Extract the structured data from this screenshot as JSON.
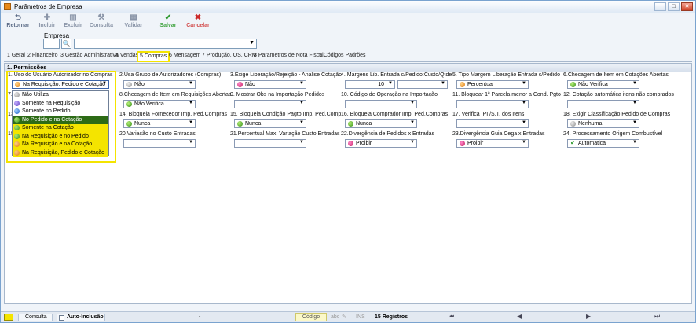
{
  "window": {
    "title": "Parâmetros de Empresa",
    "min": "_",
    "max": "□",
    "close": "✕"
  },
  "toolbar": {
    "retornar": "Retornar",
    "incluir": "Incluir",
    "excluir": "Excluir",
    "consulta": "Consulta",
    "validar": "Validar",
    "salvar": "Salvar",
    "cancelar": "Cancelar"
  },
  "empresa": {
    "label": "Empresa",
    "search_glyph": "🔍"
  },
  "tabs": [
    "1 Geral",
    "2 Financeiro",
    "3 Gestão Administrativa",
    "4 Vendas",
    "5 Compras",
    "6 Mensagem",
    "7 Produção, OS, CRM",
    "8 Parametros de Nota Fiscal",
    "9 Códigos Padrões"
  ],
  "panel": {
    "title": "1. Permissões"
  },
  "fields": {
    "f1": {
      "label": "1. Uso do Usuário Autorizador no Compras",
      "value": "Na Requisição, Pedido e Cotação"
    },
    "f2": {
      "label": "2.Usa Grupo de Autorizadores (Compras)",
      "value": "Não"
    },
    "f3": {
      "label": "3.Exige Liberação/Rejeição - Análise Cotação",
      "value": "Não"
    },
    "f4": {
      "label": "4. Margens Lib. Entrada c/Pedido:Custo/Qtde",
      "value": "10"
    },
    "f5": {
      "label": "5. Tipo Margem Liberação Entrada c/Pedido",
      "value": "Percentual"
    },
    "f6": {
      "label": "6.Checagem de Item em Cotações Abertas",
      "value": "Não Verifica"
    },
    "f7": {
      "label": "7."
    },
    "f8": {
      "label": "8.Checagem de Item em Requisições Abertas",
      "value": "Não Verifica"
    },
    "f9": {
      "label": "9. Mostrar Obs na Importação Pedidos"
    },
    "f10": {
      "label": "10. Código de Operação na Importação"
    },
    "f11": {
      "label": "11. Bloquear 1ª Parcela menor a Cond. Pgto"
    },
    "f12": {
      "label": "12. Cotação automática itens não comprados"
    },
    "f13": {
      "label": "13"
    },
    "f14": {
      "label": "14. Bloqueia Fornecedor Imp. Ped.Compras",
      "value": "Nunca"
    },
    "f15": {
      "label": "15. Bloqueia Condição Pagto Imp. Ped.Comp",
      "value": "Nunca"
    },
    "f16": {
      "label": "16. Bloqueia Comprador  Imp. Ped.Compras",
      "value": "Nunca"
    },
    "f17": {
      "label": "17. Verifica IPI /S.T. dos Itens"
    },
    "f18": {
      "label": "18. Exigir Classificação Pedido de Compras",
      "value": "Nenhuma"
    },
    "f19": {
      "label": "19"
    },
    "f20": {
      "label": "20.Variação no Custo Entradas"
    },
    "f21": {
      "label": "21.Percentual Max. Variação Custo Entradas"
    },
    "f22": {
      "label": "22.Divergência de Pedidos x Entradas",
      "value": "Proibir"
    },
    "f23": {
      "label": "23.Divergência Guia Cega x Entradas",
      "value": "Proibir"
    },
    "f24": {
      "label": "24. Processamento Origem Combustível",
      "value": "Automatica"
    }
  },
  "dropdown_options": [
    "Não Utiliza",
    "Somente na Requisição",
    "Somente no Pedido",
    "No Pedido e na Cotação",
    "Somente na Cotação",
    "Na Requisição e no Pedido",
    "Na Requisição e na Cotação",
    "Na Requisição, Pedido e Cotação"
  ],
  "statusbar": {
    "consulta": "Consulta",
    "auto_inclusao": "Auto-Inclusão",
    "dash": "-",
    "codigo": "Código",
    "abc": "abc",
    "ins": "INS",
    "registros": "15 Registros"
  },
  "colors": {
    "accent_highlight": "#f4e400",
    "selected_option": "#2d6b16",
    "border": "#7aa3cf"
  }
}
